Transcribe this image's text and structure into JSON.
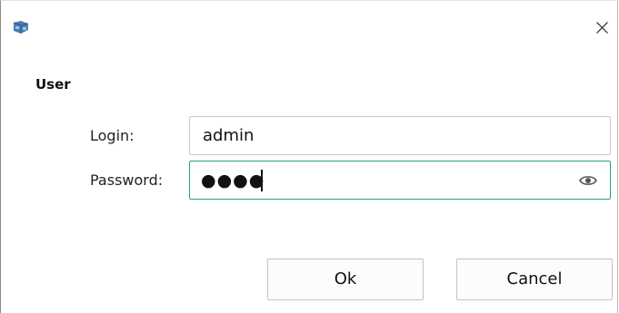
{
  "dialog": {
    "section_title": "User",
    "login_label": "Login:",
    "login_value": "admin",
    "password_label": "Password:",
    "password_masked": "●●●●",
    "ok_label": "Ok",
    "cancel_label": "Cancel"
  },
  "icons": {
    "app": "app-icon",
    "close": "close-icon",
    "show_password": "eye-icon"
  },
  "colors": {
    "focus_border": "#2c9f86",
    "app_icon": "#4a7db5"
  }
}
